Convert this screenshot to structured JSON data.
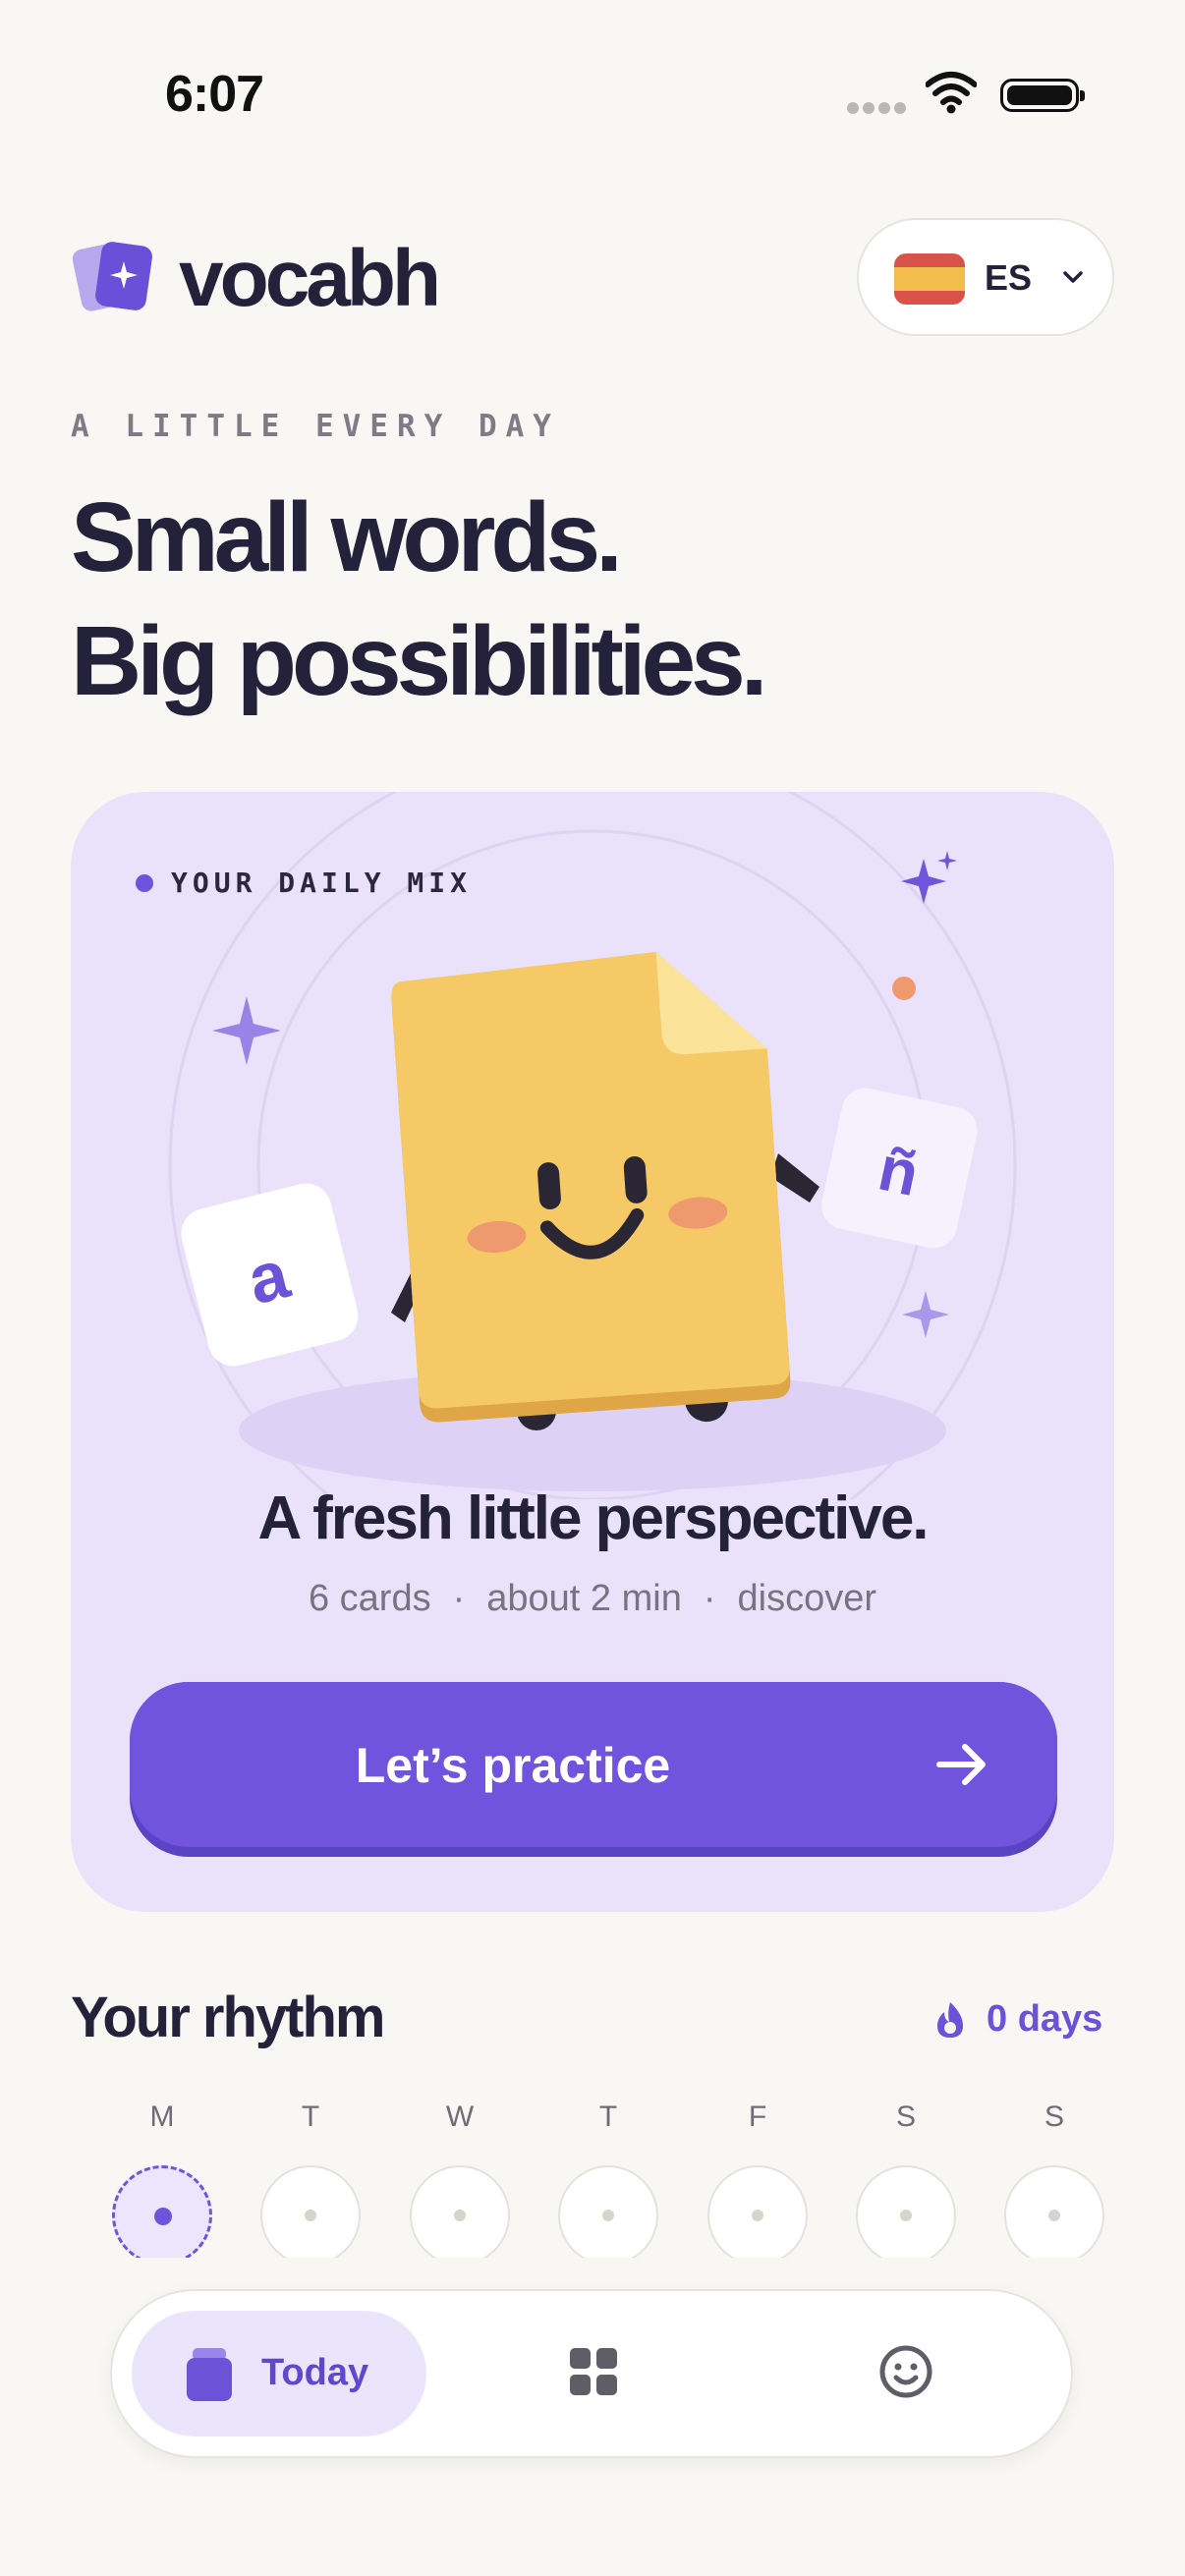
{
  "status_bar": {
    "time": "6:07"
  },
  "header": {
    "brand": "vocabh",
    "language": {
      "code": "ES",
      "flag": "spain-flag"
    }
  },
  "hero": {
    "eyebrow": "A LITTLE EVERY DAY",
    "headline_line1": "Small words.",
    "headline_line2": "Big possibilities."
  },
  "daily_mix": {
    "label": "YOUR DAILY MIX",
    "letter_left": "a",
    "letter_right": "ñ",
    "title": "A fresh little perspective.",
    "meta": [
      "6 cards",
      "about 2 min",
      "discover"
    ],
    "meta_separator": "·",
    "cta_label": "Let’s practice"
  },
  "rhythm": {
    "title": "Your rhythm",
    "streak": "0 days",
    "days": [
      "M",
      "T",
      "W",
      "T",
      "F",
      "S",
      "S"
    ],
    "today_index": 0
  },
  "nav": {
    "today_label": "Today",
    "icons": [
      "cards-icon",
      "grid-icon",
      "smiley-icon"
    ]
  },
  "colors": {
    "accent": "#7154dd",
    "card_bg": "#e9e2fa",
    "background": "#f8f7f3",
    "mascot": "#f5c966"
  }
}
